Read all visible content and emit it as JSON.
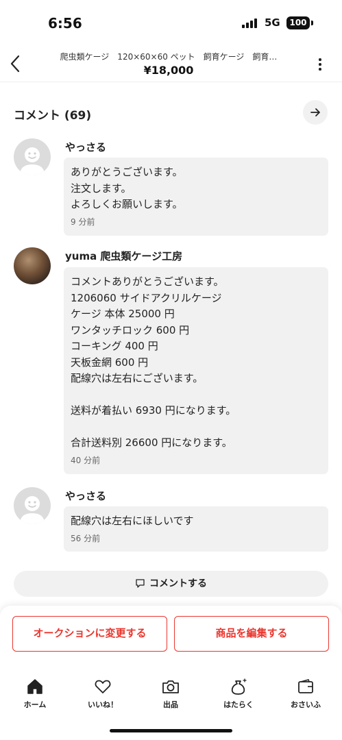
{
  "status_bar": {
    "time": "6:56",
    "network": "5G",
    "battery": "100"
  },
  "header": {
    "title": "爬虫類ケージ　120×60×60 ペット　飼育ケージ　飼育…",
    "price": "¥18,000"
  },
  "comments_section": {
    "title": "コメント (69)",
    "comments": [
      {
        "name": "やっさる",
        "avatar": "default-avatar-icon",
        "text": "ありがとうございます。\n注文します。\nよろしくお願いします。",
        "time": "9 分前"
      },
      {
        "name": "yuma 爬虫類ケージ工房",
        "avatar": "user-photo",
        "text": "コメントありがとうございます。\n1206060 サイドアクリルケージ\nケージ 本体 25000 円\nワンタッチロック 600 円\nコーキング 400 円\n天板金網 600 円\n配線穴は左右にございます。\n\n送料が着払い 6930 円になります。\n\n合計送料別 26600 円になります。",
        "time": "40 分前"
      },
      {
        "name": "やっさる",
        "avatar": "default-avatar-icon",
        "text": "配線穴は左右にほしいです",
        "time": "56 分前"
      }
    ],
    "comment_button": "コメントする"
  },
  "actions": {
    "auction_button": "オークションに変更する",
    "edit_button": "商品を編集する"
  },
  "tabbar": {
    "items": [
      {
        "label": "ホーム",
        "icon": "home-icon",
        "active": true
      },
      {
        "label": "いいね！",
        "icon": "heart-icon"
      },
      {
        "label": "出品",
        "icon": "camera-icon"
      },
      {
        "label": "はたらく",
        "icon": "money-bag-icon"
      },
      {
        "label": "おさいふ",
        "icon": "wallet-icon"
      }
    ]
  },
  "colors": {
    "accent": "#ea352d",
    "bubble": "#f1f1f1",
    "text": "#222222"
  }
}
